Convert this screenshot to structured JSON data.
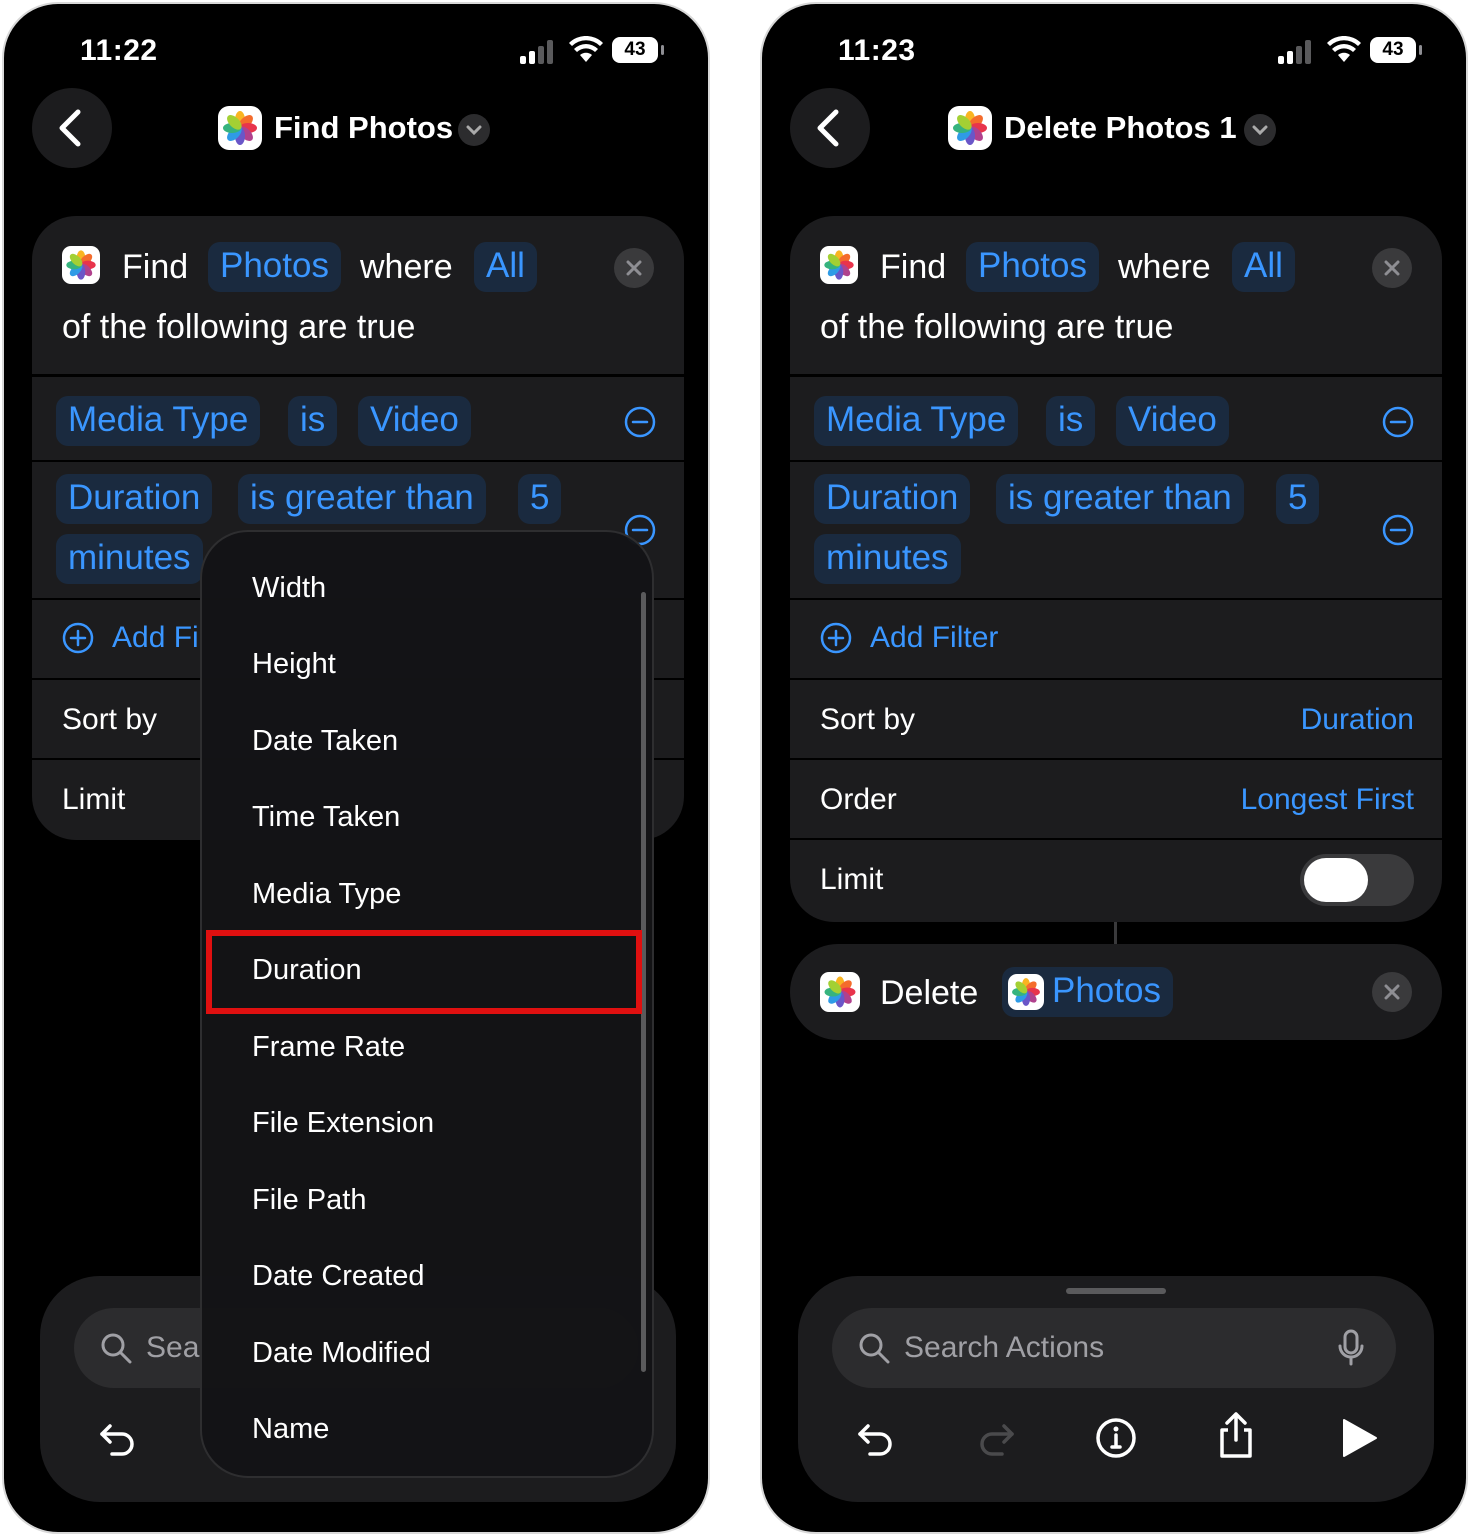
{
  "left": {
    "status_time": "11:22",
    "battery": "43",
    "nav_title": "Find Photos",
    "find_word": "Find",
    "photos_token": "Photos",
    "where_word": "where",
    "all_token": "All",
    "following": "of the following are true",
    "filter1": {
      "field": "Media Type",
      "op": "is",
      "value": "Video"
    },
    "filter2": {
      "field": "Duration",
      "op": "is greater than",
      "value": "5",
      "unit": "minutes"
    },
    "add_filter": "Add Fi",
    "sort_by": "Sort by",
    "limit": "Limit",
    "search_placeholder": "Sea",
    "menu_items": [
      "Width",
      "Height",
      "Date Taken",
      "Time Taken",
      "Media Type",
      "Duration",
      "Frame Rate",
      "File Extension",
      "File Path",
      "Date Created",
      "Date Modified",
      "Name"
    ],
    "highlighted_item": "Duration"
  },
  "right": {
    "status_time": "11:23",
    "battery": "43",
    "nav_title": "Delete Photos 1",
    "find_word": "Find",
    "photos_token": "Photos",
    "where_word": "where",
    "all_token": "All",
    "following": "of the following are true",
    "filter1": {
      "field": "Media Type",
      "op": "is",
      "value": "Video"
    },
    "filter2": {
      "field": "Duration",
      "op": "is greater than",
      "value": "5",
      "unit": "minutes"
    },
    "add_filter": "Add Filter",
    "sort_by": "Sort by",
    "sort_value": "Duration",
    "order": "Order",
    "order_value": "Longest First",
    "limit": "Limit",
    "delete_word": "Delete",
    "delete_token": "Photos",
    "search_placeholder": "Search Actions"
  },
  "colors": {
    "accent": "#3a96ff",
    "card": "#1c1c1e",
    "highlight": "#e01010"
  }
}
